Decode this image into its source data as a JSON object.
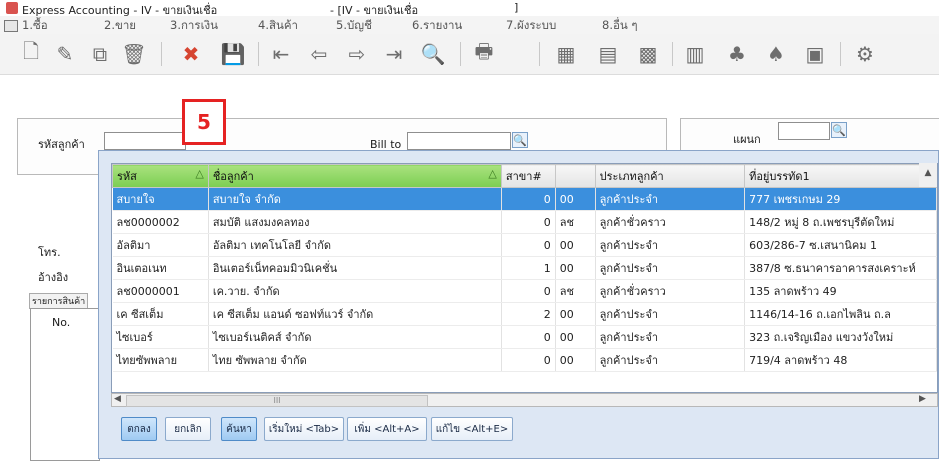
{
  "window": {
    "title": "Express Accounting - IV - ขายเงินเชื่อ",
    "title_mid": "- [IV - ขายเงินเชื่อ",
    "title_end": "]"
  },
  "menu": [
    "1.ซื้อ",
    "2.ขาย",
    "3.การเงิน",
    "4.สินค้า",
    "5.บัญชี",
    "6.รายงาน",
    "7.ผังระบบ",
    "8.อื่น ๆ"
  ],
  "toolbar": {
    "icons": [
      "new-icon",
      "edit-icon",
      "copy-icon",
      "delete-icon",
      "cancel-icon",
      "save-icon",
      "first-icon",
      "previous-icon",
      "next-icon",
      "last-icon",
      "search-icon",
      "print-icon",
      "calculator-icon",
      "form-icon",
      "grid-icon",
      "report-icon",
      "stamp-icon",
      "approve-icon",
      "document-icon",
      "settings-icon"
    ]
  },
  "form": {
    "customer_code_label": "รหัสลูกค้า",
    "bill_to_label": "Bill to",
    "department_label": "แผนก",
    "phone_label": "โทร.",
    "reference_label": "อ้างอิง",
    "items_tab_label": "รายการสินค้า",
    "no_header": "No."
  },
  "marker": {
    "label": "5",
    "color": "#e52222"
  },
  "lookup": {
    "columns": [
      "รหัส",
      "ชื่อลูกค้า",
      "สาขา#",
      "",
      "ประเภทลูกค้า",
      "ที่อยู่บรรทัด1"
    ],
    "rows": [
      [
        "สบายใจ",
        "สบายใจ จำกัด",
        "0",
        "00",
        "ลูกค้าประจำ",
        "777 เพชรเกษม 29"
      ],
      [
        "ลช0000002",
        "สมบัติ แสงมงคลทอง",
        "0",
        "ลช",
        "ลูกค้าชั่วคราว",
        "148/2 หมู่ 8 ถ.เพชรบุรีตัดใหม่"
      ],
      [
        "อัลติมา",
        "อัลติมา เทคโนโลยี จำกัด",
        "0",
        "00",
        "ลูกค้าประจำ",
        "603/286-7 ซ.เสนานิคม 1"
      ],
      [
        "อินเตอเนท",
        "อินเตอร์เน็ทคอมมิวนิเคชั่น",
        "1",
        "00",
        "ลูกค้าประจำ",
        "387/8 ซ.ธนาคารอาคารสงเคราะห์"
      ],
      [
        "ลช0000001",
        "เค.วาย. จำกัด",
        "0",
        "ลช",
        "ลูกค้าชั่วคราว",
        "135 ลาดพร้าว 49"
      ],
      [
        "เค ซีสเต็ม",
        "เค ซีสเต็ม แอนด์ ซอฟท์แวร์ จำกัด",
        "2",
        "00",
        "ลูกค้าประจำ",
        "1146/14-16 ถ.เอกไพลิน ถ.ล"
      ],
      [
        "ไซเบอร์",
        "ไซเบอร์เนติคส์ จำกัด",
        "0",
        "00",
        "ลูกค้าประจำ",
        "323 ถ.เจริญเมือง แขวงวังใหม่"
      ],
      [
        "ไทยซัพพลาย",
        "ไทย ซัพพลาย จำกัด",
        "0",
        "00",
        "ลูกค้าประจำ",
        "719/4 ลาดพร้าว 48"
      ]
    ],
    "scroll_thumb": "III",
    "buttons": [
      "ตกลง",
      "ยกเลิก",
      "ค้นหา",
      "เริ่มใหม่ <Tab>",
      "เพิ่ม <Alt+A>",
      "แก้ไข <Alt+E>"
    ]
  },
  "colors": {
    "selected_row": "#3b8fdd",
    "sorted_header": "#7ccd52",
    "popup_background": "#dde7f4"
  }
}
